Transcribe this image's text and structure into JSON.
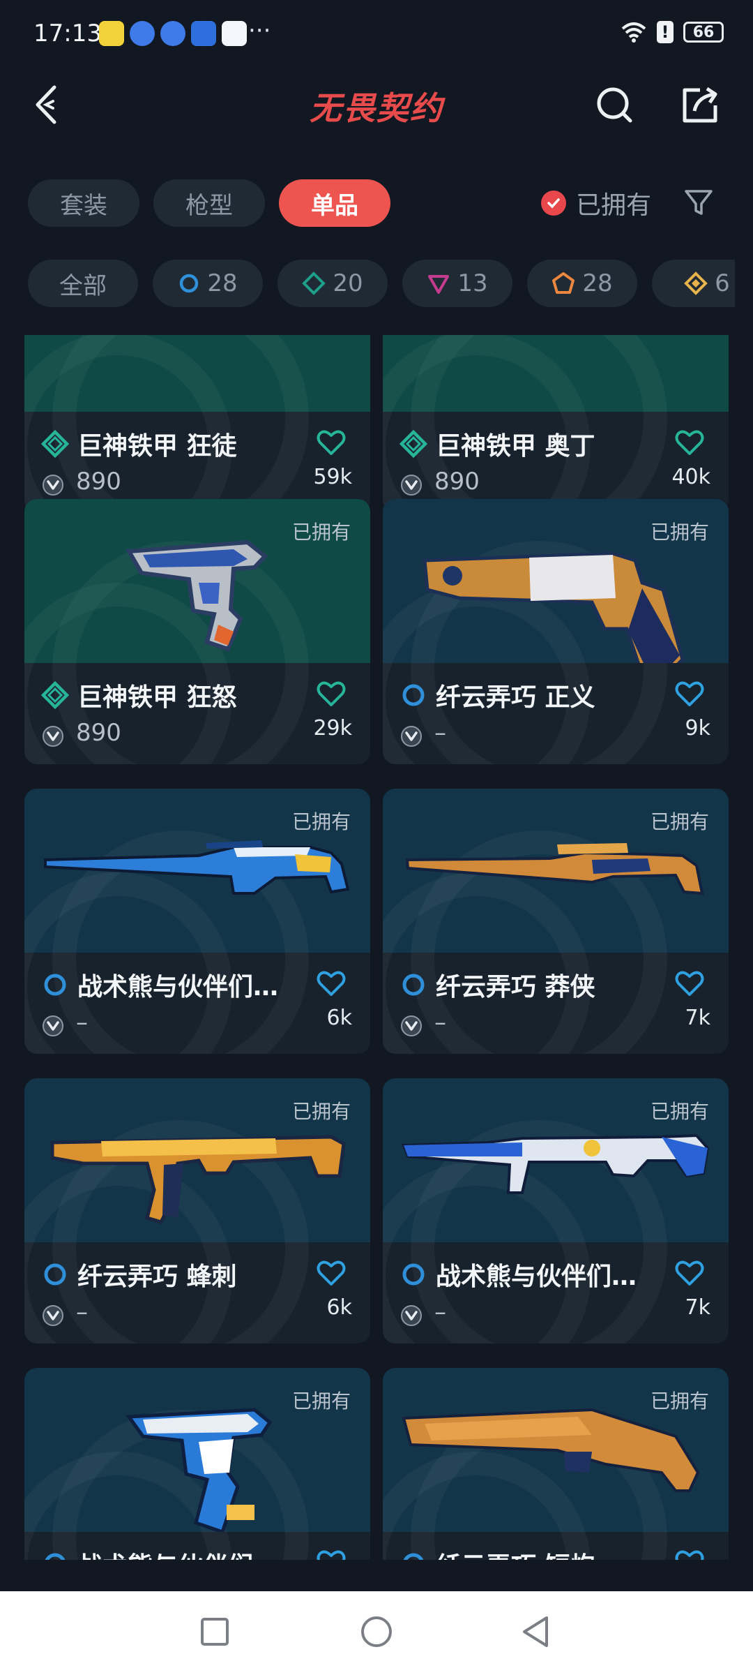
{
  "status_bar": {
    "time": "17:13",
    "dots": "···",
    "battery": "66",
    "app_icons": [
      {
        "name": "app-icon-yellow",
        "color": "#f2d33a"
      },
      {
        "name": "app-icon-blue-ball",
        "color": "#3f7be8"
      },
      {
        "name": "app-icon-blue-ball-2",
        "color": "#3f7be8"
      },
      {
        "name": "app-icon-shield",
        "color": "#2e6fdd"
      },
      {
        "name": "app-icon-cloud",
        "color": "#f3f6fa"
      }
    ]
  },
  "header": {
    "title": "无畏契约"
  },
  "tabs": [
    {
      "label": "套装",
      "active": false
    },
    {
      "label": "枪型",
      "active": false
    },
    {
      "label": "单品",
      "active": true
    }
  ],
  "owned_filter": {
    "label": "已拥有",
    "checked": true
  },
  "rarity_chips": [
    {
      "label": "全部",
      "icon": ""
    },
    {
      "label": "28",
      "icon": "select-tier-icon",
      "color": "#2f8fd8"
    },
    {
      "label": "20",
      "icon": "deluxe-tier-icon",
      "color": "#1f9e8a"
    },
    {
      "label": "13",
      "icon": "premium-tier-icon",
      "color": "#c53c8f"
    },
    {
      "label": "28",
      "icon": "exclusive-tier-icon",
      "color": "#e9863f"
    },
    {
      "label": "6",
      "icon": "ultra-tier-icon",
      "color": "#e7b34a"
    }
  ],
  "owned_tag": "已拥有",
  "cards": [
    {
      "name": "巨神铁甲 狂徒",
      "price": "890",
      "likes": "59k",
      "tier": "deluxe",
      "owned": false,
      "bg": "teal",
      "weapon": "none"
    },
    {
      "name": "巨神铁甲 奥丁",
      "price": "890",
      "likes": "40k",
      "tier": "deluxe",
      "owned": false,
      "bg": "teal",
      "weapon": "none"
    },
    {
      "name": "巨神铁甲 狂怒",
      "price": "890",
      "likes": "29k",
      "tier": "deluxe",
      "owned": true,
      "bg": "teal",
      "weapon": "pistol"
    },
    {
      "name": "纤云弄巧 正义",
      "price": "–",
      "likes": "9k",
      "tier": "select",
      "owned": true,
      "bg": "blue",
      "weapon": "revolver"
    },
    {
      "name": "战术熊与伙伴们…",
      "price": "–",
      "likes": "6k",
      "tier": "select",
      "owned": true,
      "bg": "blue",
      "weapon": "rifle"
    },
    {
      "name": "纤云弄巧 莽侠",
      "price": "–",
      "likes": "7k",
      "tier": "select",
      "owned": true,
      "bg": "blue",
      "weapon": "sniper"
    },
    {
      "name": "纤云弄巧 蜂刺",
      "price": "–",
      "likes": "6k",
      "tier": "select",
      "owned": true,
      "bg": "blue",
      "weapon": "smg"
    },
    {
      "name": "战术熊与伙伴们…",
      "price": "–",
      "likes": "7k",
      "tier": "select",
      "owned": true,
      "bg": "blue",
      "weapon": "assault"
    },
    {
      "name": "战术熊与伙伴们",
      "price": "–",
      "likes": "",
      "tier": "select",
      "owned": true,
      "bg": "blue",
      "weapon": "pistol2"
    },
    {
      "name": "纤云弄巧 短炮",
      "price": "–",
      "likes": "",
      "tier": "select",
      "owned": true,
      "bg": "blue",
      "weapon": "shotgun"
    }
  ],
  "colors": {
    "accent": "#ef5550",
    "background": "#111821",
    "card": "#17222d",
    "heart": "#2fa0e0",
    "heart_deluxe": "#27b59a"
  }
}
